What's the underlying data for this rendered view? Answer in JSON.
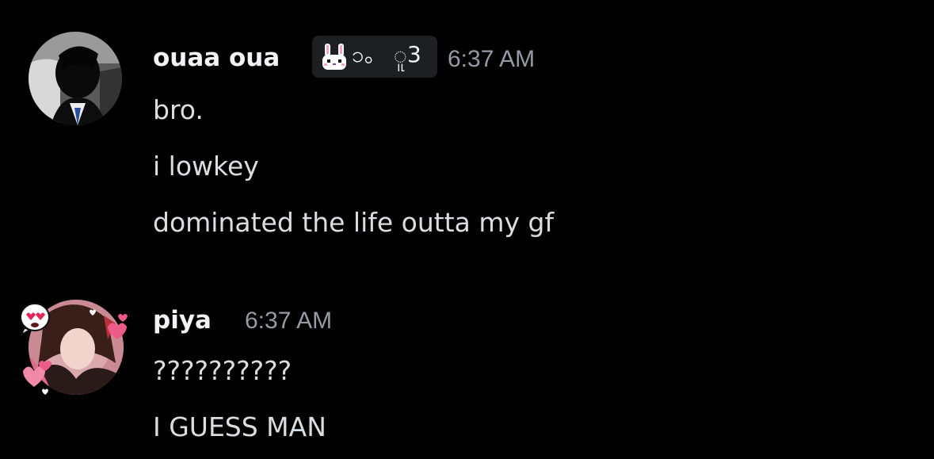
{
  "messages": [
    {
      "username": "ouaa oua",
      "tag": {
        "icon": "bunny-icon",
        "text": "၁。 ူ3"
      },
      "timestamp": "6:37 AM",
      "lines": [
        "bro.",
        "i lowkey",
        "dominated the life outta my gf"
      ]
    },
    {
      "username": "piya",
      "timestamp": "6:37 AM",
      "lines": [
        "??????????",
        "I GUESS MAN"
      ]
    }
  ],
  "colors": {
    "background": "#000000",
    "username": "#f2f3f5",
    "timestamp": "#949ba4",
    "message_text": "#dbdee1",
    "tag_bg": "#1e1f22",
    "heart_pink": "#ee5a8a"
  }
}
